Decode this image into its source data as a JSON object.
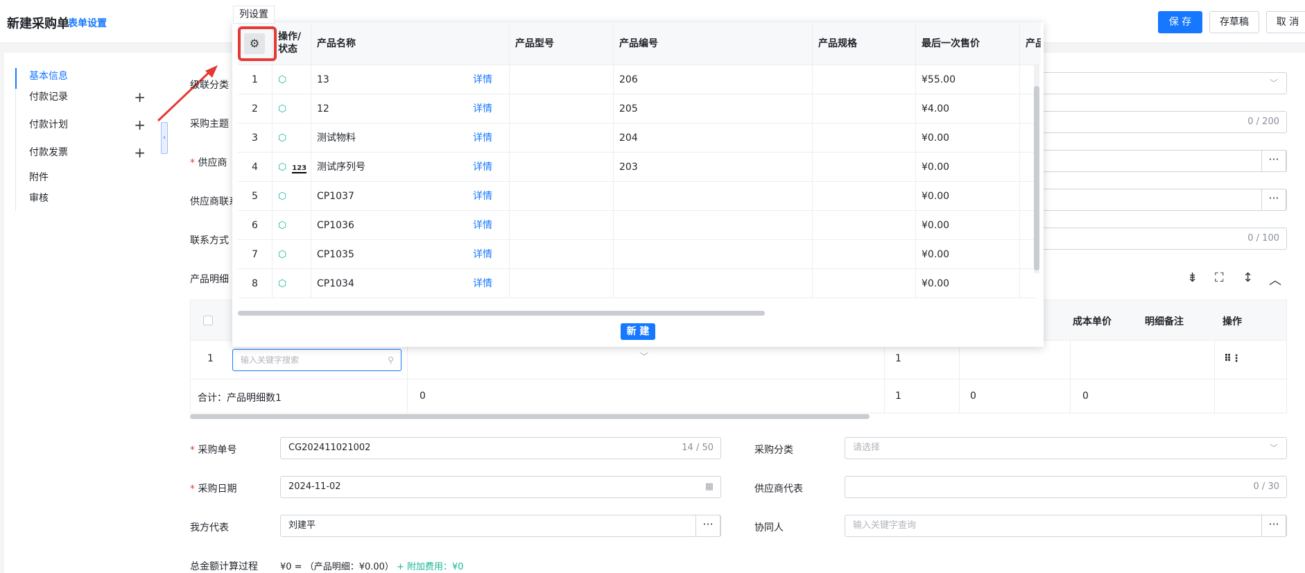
{
  "header": {
    "title": "新建采购单",
    "form_settings": "表单设置",
    "save": "保 存",
    "draft": "存草稿",
    "cancel": "取 消"
  },
  "sidebar": {
    "items": [
      {
        "label": "基本信息",
        "active": true,
        "plus": false
      },
      {
        "label": "付款记录",
        "plus": true
      },
      {
        "label": "付款计划",
        "plus": true
      },
      {
        "label": "付款发票",
        "plus": true
      },
      {
        "label": "附件",
        "plus": false
      },
      {
        "label": "审核",
        "plus": false
      }
    ]
  },
  "form_left_labels": {
    "category_partial": "级联分类",
    "subject": "采购主题",
    "supplier": "供应商",
    "supplier_contact": "供应商联系",
    "contact_method": "联系方式",
    "product_detail": "产品明细"
  },
  "form_counts": {
    "subject_count": "0 / 200",
    "contact_count": "0 / 100"
  },
  "detail_table": {
    "headers_visible": [
      "成本单价",
      "明细备注",
      "操作"
    ],
    "row": {
      "index": "1",
      "search_placeholder": "输入关键字搜索",
      "qty": "1"
    },
    "total_row": {
      "label": "合计：产品明细数1",
      "v1": "0",
      "v2": "1",
      "v3": "0",
      "v4": "0"
    }
  },
  "lower_form": {
    "order_no_label": "采购单号",
    "order_no_value": "CG202411021002",
    "order_no_count": "14 / 50",
    "category_label": "采购分类",
    "category_placeholder": "请选择",
    "date_label": "采购日期",
    "date_value": "2024-11-02",
    "supplier_rep_label": "供应商代表",
    "supplier_rep_count": "0 / 30",
    "our_rep_label": "我方代表",
    "our_rep_value": "刘建平",
    "co_person_label": "协同人",
    "co_person_placeholder": "输入关键字查询",
    "total_calc_label": "总金额计算过程",
    "total_calc_main": "¥0 = （产品明细：¥0.00）",
    "total_calc_extra": "+ 附加费用：¥0"
  },
  "popup": {
    "tooltip": "列设置",
    "headers": [
      "操作/状态",
      "产品名称",
      "产品型号",
      "产品编号",
      "产品规格",
      "最后一次售价",
      "产品"
    ],
    "rows": [
      {
        "no": "1",
        "name": "13",
        "detail": "详情",
        "code": "206",
        "price": "¥55.00",
        "serial": false
      },
      {
        "no": "2",
        "name": "12",
        "detail": "详情",
        "code": "205",
        "price": "¥4.00",
        "serial": false
      },
      {
        "no": "3",
        "name": "测试物料",
        "detail": "详情",
        "code": "204",
        "price": "¥0.00",
        "serial": false
      },
      {
        "no": "4",
        "name": "测试序列号",
        "detail": "详情",
        "code": "203",
        "price": "¥0.00",
        "serial": true
      },
      {
        "no": "5",
        "name": "CP1037",
        "detail": "详情",
        "code": "",
        "price": "¥0.00",
        "serial": false
      },
      {
        "no": "6",
        "name": "CP1036",
        "detail": "详情",
        "code": "",
        "price": "¥0.00",
        "serial": false
      },
      {
        "no": "7",
        "name": "CP1035",
        "detail": "详情",
        "code": "",
        "price": "¥0.00",
        "serial": false
      },
      {
        "no": "8",
        "name": "CP1034",
        "detail": "详情",
        "code": "",
        "price": "¥0.00",
        "serial": false
      }
    ],
    "new_button": "新 建"
  },
  "icons": {
    "gear": "gear-icon",
    "package": "package-icon",
    "serial": "serial-number-icon"
  },
  "colors": {
    "primary": "#1677ff",
    "required": "#e53935",
    "highlight": "#e53935",
    "package": "#18b596"
  }
}
